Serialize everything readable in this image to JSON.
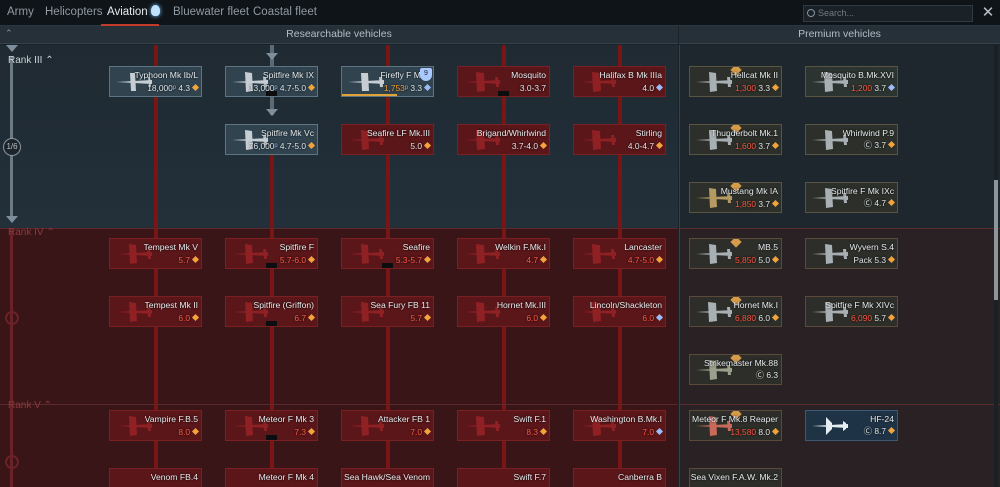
{
  "tabs": [
    {
      "label": "Army"
    },
    {
      "label": "Helicopters"
    },
    {
      "label": "Aviation"
    },
    {
      "label": "Bluewater fleet"
    },
    {
      "label": "Coastal fleet"
    }
  ],
  "active_tab": "Aviation",
  "search": {
    "placeholder": "Search..."
  },
  "headers": {
    "researchable": "Researchable vehicles",
    "premium": "Premium vehicles"
  },
  "ranks": {
    "r3": "Rank III",
    "r4": "Rank IV",
    "r5": "Rank V",
    "progress": "1/6"
  },
  "colors": {
    "locked_red": "#5a1619",
    "accent_red": "#c23a2a",
    "premium_gold": "#e0a33a",
    "cost_red": "#ff5a45"
  },
  "research": {
    "typhoon": {
      "name": "Typhoon Mk Ib/L",
      "cost": "18,000",
      "br": "4.3"
    },
    "spit9": {
      "name": "Spitfire Mk IX",
      "cost": "13,000",
      "br": "4.7-5.0"
    },
    "firefly": {
      "name": "Firefly F Mk I",
      "cost": "1,753",
      "br": "3.3",
      "badge": "9"
    },
    "mosquito": {
      "name": "Mosquito",
      "br": "3.0-3.7"
    },
    "halifax": {
      "name": "Halifax B Mk IIIa",
      "br": "4.0"
    },
    "spit5c": {
      "name": "Spitfire Mk Vc",
      "cost": "76,000",
      "br": "4.7-5.0"
    },
    "seafire_lf": {
      "name": "Seafire LF Mk.III",
      "br": "5.0"
    },
    "brigand": {
      "name": "Brigand/Whirlwind",
      "br": "3.7-4.0"
    },
    "stirling": {
      "name": "Stirling",
      "br": "4.0-4.7"
    },
    "tempest5": {
      "name": "Tempest Mk V",
      "br": "5.7"
    },
    "spitf": {
      "name": "Spitfire F",
      "br": "5.7-6.0"
    },
    "seafire": {
      "name": "Seafire",
      "br": "5.3-5.7"
    },
    "welkin": {
      "name": "Welkin F.Mk.I",
      "br": "4.7"
    },
    "lancaster": {
      "name": "Lancaster",
      "br": "4.7-5.0"
    },
    "tempest2": {
      "name": "Tempest Mk II",
      "br": "6.0"
    },
    "griffon": {
      "name": "Spitfire (Griffon)",
      "br": "6.7"
    },
    "seafury": {
      "name": "Sea Fury FB 11",
      "br": "5.7"
    },
    "hornet3": {
      "name": "Hornet Mk.III",
      "br": "6.0"
    },
    "lincoln": {
      "name": "Lincoln/Shackleton",
      "br": "6.0"
    },
    "vampire": {
      "name": "Vampire F.B.5",
      "br": "8.0"
    },
    "meteor3": {
      "name": "Meteor F Mk 3",
      "br": "7.3"
    },
    "attacker": {
      "name": "Attacker FB 1",
      "br": "7.0"
    },
    "swift1": {
      "name": "Swift F.1",
      "br": "8.3"
    },
    "washington": {
      "name": "Washington B.Mk.I",
      "br": "7.0"
    },
    "venom": {
      "name": "Venom FB.4"
    },
    "meteor4": {
      "name": "Meteor F Mk 4"
    },
    "seahawk": {
      "name": "Sea Hawk/Sea Venom"
    },
    "swift7": {
      "name": "Swift F.7"
    },
    "canberra": {
      "name": "Canberra B"
    }
  },
  "premium": {
    "hellcat": {
      "name": "Hellcat Mk II",
      "cost": "1,300",
      "br": "3.3"
    },
    "mosquito16": {
      "name": "Mosquito B.Mk.XVI",
      "cost": "1,200",
      "br": "3.7"
    },
    "thunderbolt": {
      "name": "Thunderbolt Mk.1",
      "cost": "1,600",
      "br": "3.7"
    },
    "whirlwind": {
      "name": "Whirlwind P.9",
      "br": "3.7"
    },
    "mustang": {
      "name": "Mustang Mk IA",
      "cost": "1,850",
      "br": "3.7"
    },
    "spit9c": {
      "name": "Spitfire F Mk IXc",
      "br": "4.7"
    },
    "mb5": {
      "name": "MB.5",
      "cost": "5,850",
      "br": "5.0"
    },
    "wyvern": {
      "name": "Wyvern S.4",
      "br": "5.3",
      "pack": "Pack"
    },
    "hornet1": {
      "name": "Hornet Mk.I",
      "cost": "6,880",
      "br": "6.0"
    },
    "spit14": {
      "name": "Spitfire F Mk XIVc",
      "cost": "6,090",
      "br": "5.7"
    },
    "strikemaster": {
      "name": "Strikemaster Mk.88",
      "br": "6.3"
    },
    "meteor8": {
      "name": "Meteor F Mk.8 Reaper",
      "cost": "13,580",
      "br": "8.0"
    },
    "hf24": {
      "name": "HF-24",
      "br": "8.7"
    },
    "seavixen": {
      "name": "Sea Vixen F.A.W. Mk.2"
    }
  }
}
